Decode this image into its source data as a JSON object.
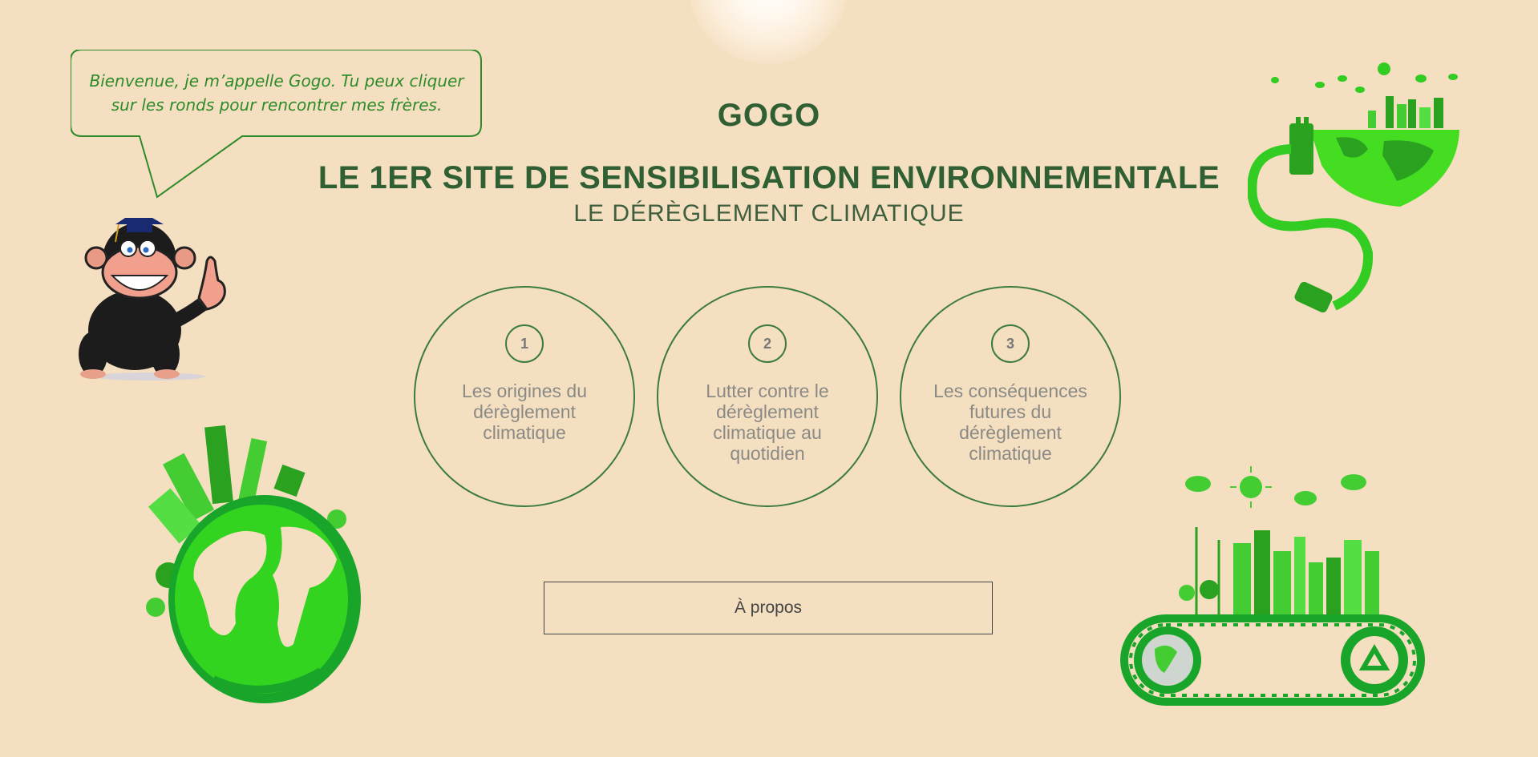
{
  "mascot": {
    "speech": "Bienvenue, je m’appelle Gogo. Tu peux cliquer sur les ronds pour rencontrer mes frères."
  },
  "header": {
    "name": "GOGO",
    "title": "LE 1ER SITE DE SENSIBILISATION ENVIRONNEMENTALE",
    "subtitle": "LE DÉRÈGLEMENT CLIMATIQUE"
  },
  "topics": [
    {
      "number": "1",
      "label": "Les origines du dérèglement climatique"
    },
    {
      "number": "2",
      "label": "Lutter contre le dérèglement climatique au quotidien"
    },
    {
      "number": "3",
      "label": "Les conséquences futures du dérèglement climatique"
    }
  ],
  "about_label": "À propos",
  "colors": {
    "background": "#f5dfc1",
    "title": "#2f5f33",
    "accent_green": "#3b7c3a",
    "eco_green": "#33cc22"
  }
}
